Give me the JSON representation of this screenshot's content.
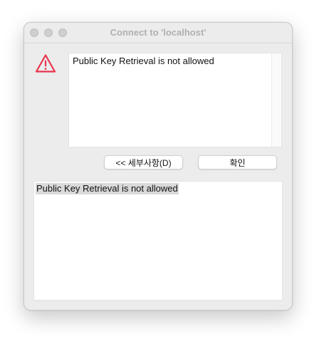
{
  "window": {
    "title": "Connect to 'localhost'"
  },
  "dialog": {
    "message": "Public Key Retrieval is not allowed",
    "icon": "warning-icon",
    "accent_color": "#e8344e"
  },
  "buttons": {
    "details_label": "<< 세부사항(D)",
    "ok_label": "확인"
  },
  "details": {
    "text": "Public Key Retrieval is not allowed"
  }
}
